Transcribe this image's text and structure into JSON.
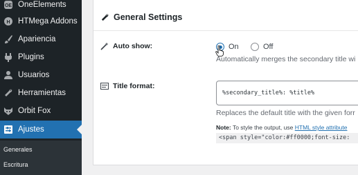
{
  "sidebar": {
    "items": [
      {
        "label": "OneElements",
        "icon": "oneelements-icon"
      },
      {
        "label": "HTMega Addons",
        "icon": "htmega-icon"
      },
      {
        "label": "Apariencia",
        "icon": "paintbrush-icon"
      },
      {
        "label": "Plugins",
        "icon": "plugin-icon"
      },
      {
        "label": "Usuarios",
        "icon": "user-icon"
      },
      {
        "label": "Herramientas",
        "icon": "wrench-icon"
      },
      {
        "label": "Orbit Fox",
        "icon": "fox-icon"
      },
      {
        "label": "Ajustes",
        "icon": "settings-icon",
        "active": true
      }
    ],
    "submenu": [
      {
        "label": "Generales"
      },
      {
        "label": "Escritura"
      }
    ]
  },
  "panel": {
    "title": "General Settings",
    "auto_show": {
      "label": "Auto show:",
      "options": [
        "On",
        "Off"
      ],
      "selected": "On",
      "description": "Automatically merges the secondary title wi"
    },
    "title_format": {
      "label": "Title format:",
      "value": "%secondary_title%: %title%",
      "description": "Replaces the default title with the given forr",
      "note_prefix": "Note:",
      "note_text": " To style the output, use ",
      "note_link": "HTML style attribute",
      "code": "<span style=\"color:#ff0000;font-size:"
    }
  },
  "colors": {
    "sidebar_bg": "#1d2327",
    "active_bg": "#2271b1",
    "link": "#2271b1"
  }
}
